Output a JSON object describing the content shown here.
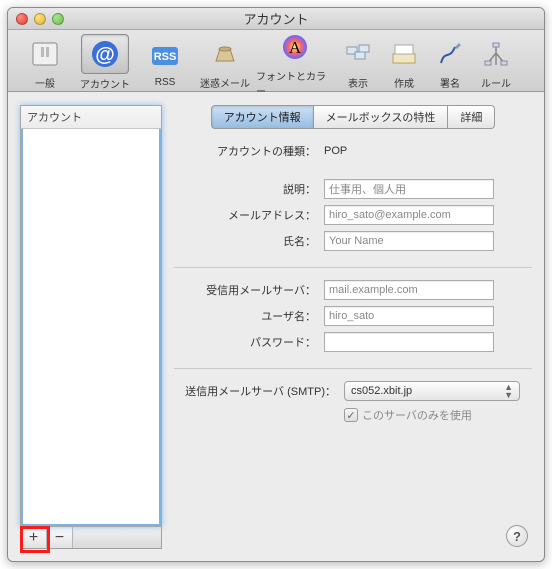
{
  "window": {
    "title": "アカウント"
  },
  "toolbar": {
    "items": [
      {
        "label": "一般"
      },
      {
        "label": "アカウント"
      },
      {
        "label": "RSS"
      },
      {
        "label": "迷惑メール"
      },
      {
        "label": "フォントとカラー"
      },
      {
        "label": "表示"
      },
      {
        "label": "作成"
      },
      {
        "label": "署名"
      },
      {
        "label": "ルール"
      }
    ]
  },
  "sidebar": {
    "header": "アカウント",
    "add_symbol": "+",
    "remove_symbol": "−"
  },
  "tabs": {
    "info": "アカウント情報",
    "mailbox": "メールボックスの特性",
    "advanced": "詳細"
  },
  "form": {
    "type_label": "アカウントの種類：",
    "type_value": "POP",
    "desc_label": "説明：",
    "desc_value": "仕事用、個人用",
    "email_label": "メールアドレス：",
    "email_value": "hiro_sato@example.com",
    "name_label": "氏名：",
    "name_value": "Your Name",
    "incoming_label": "受信用メールサーバ：",
    "incoming_value": "mail.example.com",
    "user_label": "ユーザ名：",
    "user_value": "hiro_sato",
    "pass_label": "パスワード：",
    "pass_value": "",
    "smtp_label": "送信用メールサーバ (SMTP)：",
    "smtp_value": "cs052.xbit.jp",
    "only_this": "このサーバのみを使用"
  },
  "help": "?"
}
